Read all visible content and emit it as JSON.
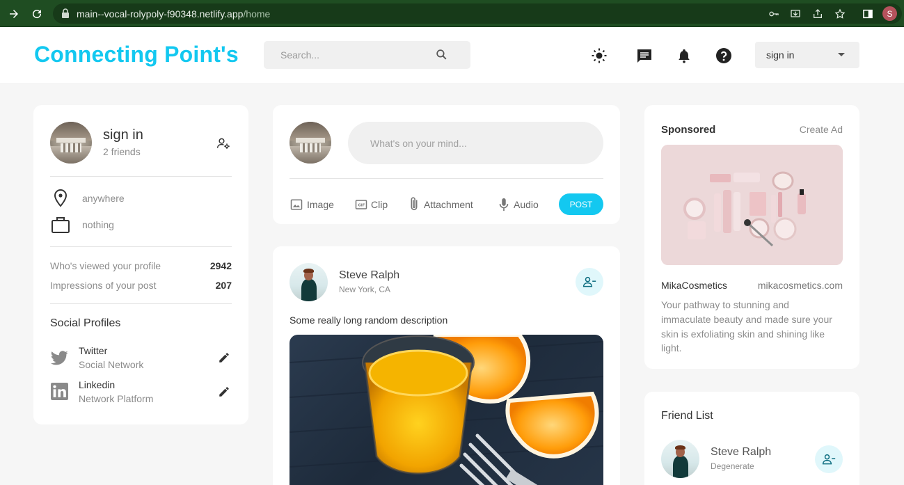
{
  "browser": {
    "url_host": "main--vocal-rolypoly-f90348.netlify.app",
    "url_path": "/home",
    "profile_initial": "S"
  },
  "header": {
    "logo": "Connecting Point's",
    "search_placeholder": "Search...",
    "signin_label": "sign in",
    "icons": [
      "sun-icon",
      "chat-icon",
      "bell-icon",
      "help-icon"
    ]
  },
  "profile_card": {
    "name": "sign in",
    "friends": "2 friends",
    "location": "anywhere",
    "work": "nothing",
    "stats": [
      {
        "label": "Who's viewed your profile",
        "value": "2942"
      },
      {
        "label": "Impressions of your post",
        "value": "207"
      }
    ],
    "social_title": "Social Profiles",
    "socials": [
      {
        "name": "Twitter",
        "type": "Social Network"
      },
      {
        "name": "Linkedin",
        "type": "Network Platform"
      }
    ]
  },
  "composer": {
    "placeholder": "What's on your mind...",
    "actions": [
      "Image",
      "Clip",
      "Attachment",
      "Audio"
    ],
    "post_label": "POST"
  },
  "post": {
    "author": "Steve Ralph",
    "location": "New York, CA",
    "description": "Some really long random description"
  },
  "sponsored": {
    "title": "Sponsored",
    "create_ad": "Create Ad",
    "brand": "MikaCosmetics",
    "site": "mikacosmetics.com",
    "text_lines": [
      "Your pathway to stunning and",
      "immaculate beauty and made sure your",
      "skin is exfoliating skin and shining like",
      "light."
    ]
  },
  "friends": {
    "title": "Friend List",
    "items": [
      {
        "name": "Steve Ralph",
        "subtitle": "Degenerate"
      }
    ]
  },
  "colors": {
    "accent": "#13c8f0",
    "browser_bar": "#1f4d22",
    "page_bg": "#f6f6f6",
    "card_bg": "#ffffff"
  }
}
